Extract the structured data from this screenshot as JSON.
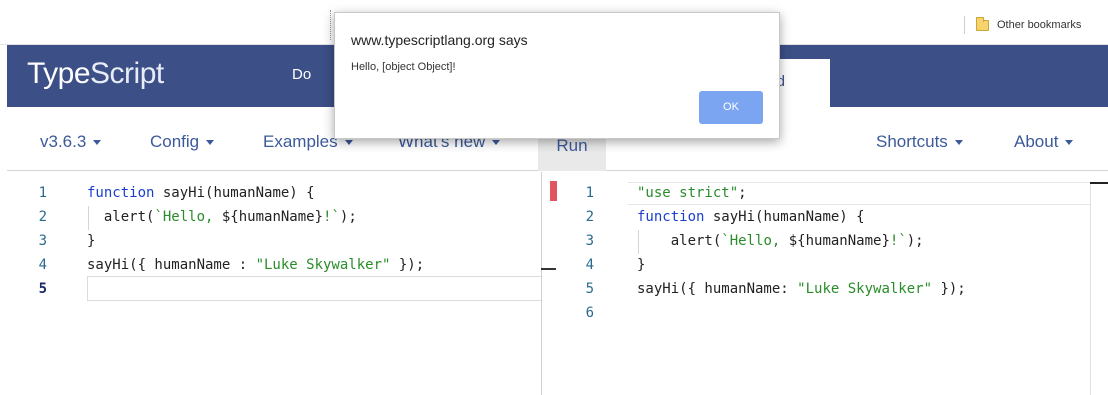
{
  "browser": {
    "bookmarks": {
      "folder_label": "Other bookmarks"
    }
  },
  "header": {
    "logo_type": "Type",
    "logo_script": "Script",
    "nav_docs": "Do",
    "nav_playground": "und"
  },
  "toolbar": {
    "version": "v3.6.3",
    "config": "Config",
    "examples": "Examples",
    "whats_new": "What's new",
    "run": "Run",
    "shortcuts": "Shortcuts",
    "about": "About"
  },
  "editor_left": {
    "lines": [
      {
        "num": "1",
        "parts": [
          [
            "kw",
            "function"
          ],
          [
            "t",
            " sayHi(humanName) {"
          ]
        ]
      },
      {
        "num": "2",
        "parts": [
          [
            "t",
            "  alert("
          ],
          [
            "str",
            "`Hello, "
          ],
          [
            "t",
            "${humanName}"
          ],
          [
            "str",
            "!`"
          ],
          [
            "t",
            ");"
          ]
        ]
      },
      {
        "num": "3",
        "parts": [
          [
            "t",
            "}"
          ]
        ]
      },
      {
        "num": "4",
        "parts": [
          [
            "t",
            "sayHi({ humanName : "
          ],
          [
            "str",
            "\"Luke Skywalker\""
          ],
          [
            "t",
            " });"
          ]
        ]
      },
      {
        "num": "5",
        "parts": []
      }
    ]
  },
  "editor_right": {
    "lines": [
      {
        "num": "1",
        "parts": [
          [
            "str",
            "\"use strict\""
          ],
          [
            "t",
            ";"
          ]
        ]
      },
      {
        "num": "2",
        "parts": [
          [
            "kw",
            "function"
          ],
          [
            "t",
            " sayHi(humanName) {"
          ]
        ]
      },
      {
        "num": "3",
        "parts": [
          [
            "t",
            "    alert("
          ],
          [
            "str",
            "`Hello, "
          ],
          [
            "t",
            "${humanName}"
          ],
          [
            "str",
            "!`"
          ],
          [
            "t",
            ");"
          ]
        ]
      },
      {
        "num": "4",
        "parts": [
          [
            "t",
            "}"
          ]
        ]
      },
      {
        "num": "5",
        "parts": [
          [
            "t",
            "sayHi({ humanName: "
          ],
          [
            "str",
            "\"Luke Skywalker\""
          ],
          [
            "t",
            " });"
          ]
        ]
      },
      {
        "num": "6",
        "parts": []
      }
    ]
  },
  "dialog": {
    "title": "www.typescriptlang.org says",
    "message": "Hello, [object Object]!",
    "ok_label": "OK"
  },
  "colors": {
    "header_bg": "#3c4f86",
    "link": "#3c5a9a",
    "keyword": "#1a3fcf",
    "string": "#2a8c2a",
    "ok_button": "#7ba5f0",
    "error_marker": "#e0555f"
  }
}
